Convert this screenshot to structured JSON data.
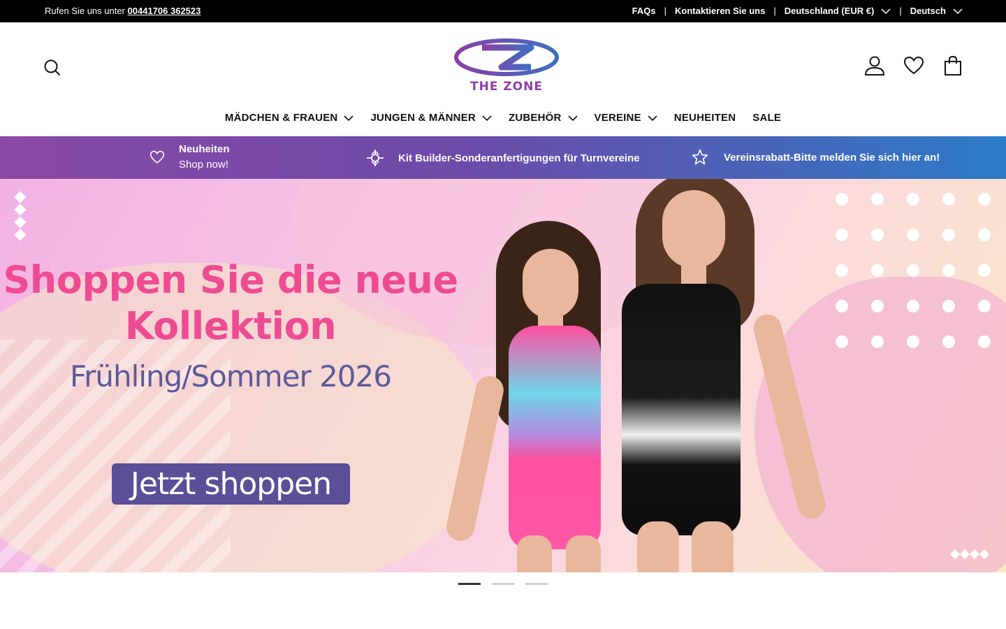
{
  "topbar": {
    "phone_prefix": "Rufen Sie uns unter",
    "phone_number": "00441706 362523",
    "faqs": "FAQs",
    "contact": "Kontaktieren Sie uns",
    "currency": "Deutschland (EUR €)",
    "language": "Deutsch",
    "separator": "|"
  },
  "header": {
    "logo_text": "THE ZONE",
    "icons": [
      "search-icon",
      "account-icon",
      "heart-icon",
      "bag-icon"
    ]
  },
  "nav": {
    "items": [
      {
        "label": "MÄDCHEN & FRAUEN",
        "dropdown": true
      },
      {
        "label": "JUNGEN & MÄNNER",
        "dropdown": true
      },
      {
        "label": "ZUBEHÖR",
        "dropdown": true
      },
      {
        "label": "VEREINE",
        "dropdown": true
      },
      {
        "label": "NEUHEITEN",
        "dropdown": false
      },
      {
        "label": "SALE",
        "dropdown": false
      }
    ]
  },
  "promo": {
    "item1_title": "Neuheiten",
    "item1_sub": "Shop now!",
    "item2": "Kit Builder-Sonderanfertigungen für Turnvereine",
    "item3": "Vereinsrabatt-Bitte melden Sie sich hier an!",
    "gradient": [
      "#8a4aa6",
      "#2a7bc8"
    ]
  },
  "hero": {
    "headline_line1": "Shoppen Sie die neue",
    "headline_line2": "Kollektion",
    "season": "Frühling/Sommer 2026",
    "cta": "Jetzt shoppen",
    "headline_color": "#ee4c92",
    "cta_color": "#5b4f98"
  },
  "slider": {
    "count": 3,
    "active_index": 0
  }
}
